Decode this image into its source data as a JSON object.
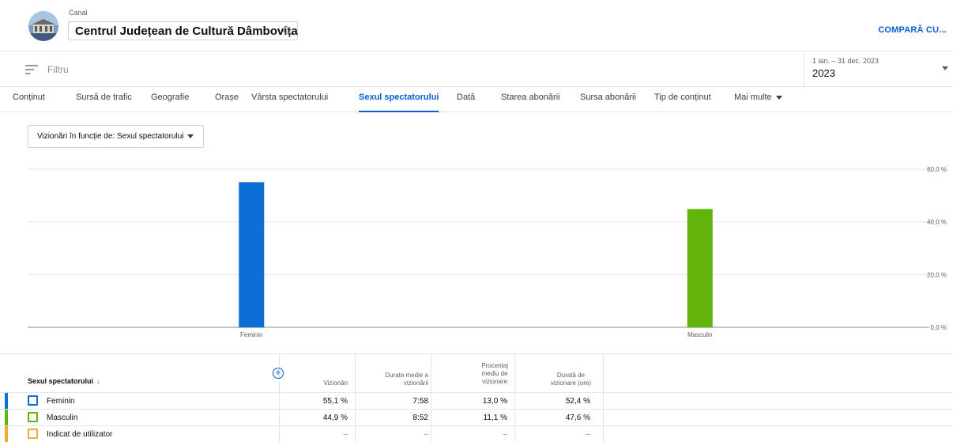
{
  "header": {
    "canal_label": "Canal",
    "channel_name": "Centrul Județean de Cultură Dâmbovița",
    "compare_label": "COMPARĂ CU..."
  },
  "filter": {
    "placeholder": "Filtru"
  },
  "date": {
    "range": "1 ian. – 31 dec. 2023",
    "year": "2023"
  },
  "tabs": [
    {
      "label": "Conținut",
      "active": false
    },
    {
      "label": "Sursă de trafic",
      "active": false
    },
    {
      "label": "Geografie",
      "active": false
    },
    {
      "label": "Orașe",
      "active": false
    },
    {
      "label": "Vârsta spectatorului",
      "active": false
    },
    {
      "label": "Sexul spectatorului",
      "active": true
    },
    {
      "label": "Dată",
      "active": false
    },
    {
      "label": "Starea abonării",
      "active": false
    },
    {
      "label": "Sursa abonării",
      "active": false
    },
    {
      "label": "Tip de conținut",
      "active": false
    },
    {
      "label": "Mai multe",
      "active": false
    }
  ],
  "metric_dropdown": {
    "label": "Vizionări în funcție de: Sexul spectatorului"
  },
  "chart_data": {
    "type": "bar",
    "categories": [
      "Feminin",
      "Masculin"
    ],
    "values": [
      55.1,
      44.9
    ],
    "colors": [
      "#0b6fd6",
      "#5fb30a"
    ],
    "ylim": [
      0,
      60
    ],
    "yticks": [
      "0,0 %",
      "20,0 %",
      "40,0 %",
      "60,0 %"
    ],
    "ytick_values": [
      0,
      20,
      40,
      60
    ],
    "grid": true
  },
  "table": {
    "dimension_header": "Sexul spectatorului",
    "sort_icon": "arrow-down-icon",
    "add_icon": "plus-circle-icon",
    "columns": [
      [
        "Vizionări"
      ],
      [
        "Durata medie a",
        "vizionării"
      ],
      [
        "Procentaj",
        "mediu de",
        "vizionare"
      ],
      [
        "Durată de",
        "vizionare (ore)"
      ]
    ],
    "rows": [
      {
        "label": "Feminin",
        "color": "#0b6fd6",
        "values": [
          "55,1 %",
          "7:58",
          "13,0 %",
          "52,4 %"
        ]
      },
      {
        "label": "Masculin",
        "color": "#5fb30a",
        "values": [
          "44,9 %",
          "8:52",
          "11,1 %",
          "47,6 %"
        ]
      },
      {
        "label": "Indicat de utilizator",
        "color": "#f3a83b",
        "values": [
          "–",
          "–",
          "–",
          "–"
        ]
      }
    ]
  }
}
